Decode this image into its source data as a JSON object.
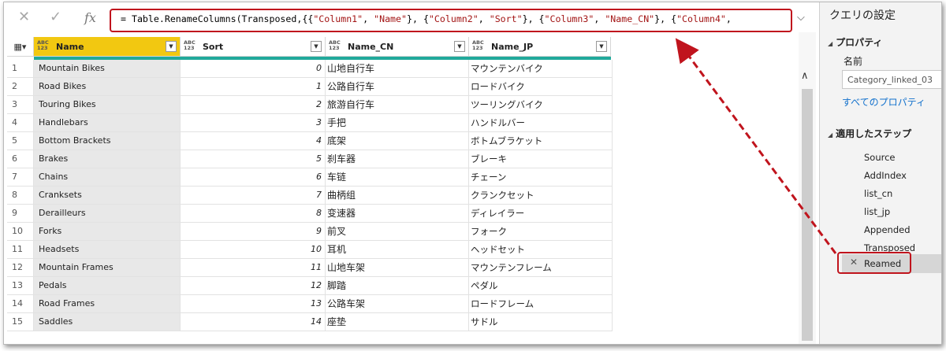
{
  "formula_bar": {
    "cancel_icon": "✕",
    "check_icon": "✓",
    "fx_label": "fx",
    "formula_parts": [
      {
        "t": "= Table.RenameColumns(Transposed,{{",
        "s": false
      },
      {
        "t": "\"Column1\"",
        "s": true
      },
      {
        "t": ", ",
        "s": false
      },
      {
        "t": "\"Name\"",
        "s": true
      },
      {
        "t": "}, {",
        "s": false
      },
      {
        "t": "\"Column2\"",
        "s": true
      },
      {
        "t": ", ",
        "s": false
      },
      {
        "t": "\"Sort\"",
        "s": true
      },
      {
        "t": "}, {",
        "s": false
      },
      {
        "t": "\"Column3\"",
        "s": true
      },
      {
        "t": ", ",
        "s": false
      },
      {
        "t": "\"Name_CN\"",
        "s": true
      },
      {
        "t": "}, {",
        "s": false
      },
      {
        "t": "\"Column4\"",
        "s": true
      },
      {
        "t": ",",
        "s": false
      }
    ],
    "expand_icon": "chevron-down-icon"
  },
  "table": {
    "type_badge": "ABC\n123",
    "columns": [
      {
        "label": "Name",
        "selected": true
      },
      {
        "label": "Sort",
        "selected": false
      },
      {
        "label": "Name_CN",
        "selected": false
      },
      {
        "label": "Name_JP",
        "selected": false
      }
    ],
    "rows": [
      {
        "idx": "1",
        "name": "Mountain Bikes",
        "sort": "0",
        "cn": "山地自行车",
        "jp": "マウンテンバイク"
      },
      {
        "idx": "2",
        "name": "Road Bikes",
        "sort": "1",
        "cn": "公路自行车",
        "jp": "ロードバイク"
      },
      {
        "idx": "3",
        "name": "Touring Bikes",
        "sort": "2",
        "cn": "旅游自行车",
        "jp": "ツーリングバイク"
      },
      {
        "idx": "4",
        "name": "Handlebars",
        "sort": "3",
        "cn": "手把",
        "jp": "ハンドルバー"
      },
      {
        "idx": "5",
        "name": "Bottom Brackets",
        "sort": "4",
        "cn": "底架",
        "jp": "ボトムブラケット"
      },
      {
        "idx": "6",
        "name": "Brakes",
        "sort": "5",
        "cn": "刹车器",
        "jp": "ブレーキ"
      },
      {
        "idx": "7",
        "name": "Chains",
        "sort": "6",
        "cn": "车链",
        "jp": "チェーン"
      },
      {
        "idx": "8",
        "name": "Cranksets",
        "sort": "7",
        "cn": "曲柄组",
        "jp": "クランクセット"
      },
      {
        "idx": "9",
        "name": "Derailleurs",
        "sort": "8",
        "cn": "变速器",
        "jp": "ディレイラー"
      },
      {
        "idx": "10",
        "name": "Forks",
        "sort": "9",
        "cn": "前叉",
        "jp": "フォーク"
      },
      {
        "idx": "11",
        "name": "Headsets",
        "sort": "10",
        "cn": "耳机",
        "jp": "ヘッドセット"
      },
      {
        "idx": "12",
        "name": "Mountain Frames",
        "sort": "11",
        "cn": "山地车架",
        "jp": "マウンテンフレーム"
      },
      {
        "idx": "13",
        "name": "Pedals",
        "sort": "12",
        "cn": "脚踏",
        "jp": "ペダル"
      },
      {
        "idx": "14",
        "name": "Road Frames",
        "sort": "13",
        "cn": "公路车架",
        "jp": "ロードフレーム"
      },
      {
        "idx": "15",
        "name": "Saddles",
        "sort": "14",
        "cn": "座垫",
        "jp": "サドル"
      }
    ]
  },
  "query_settings": {
    "title": "クエリの設定",
    "properties_heading": "プロパティ",
    "name_label": "名前",
    "name_value": "Category_linked_03",
    "all_properties_link": "すべてのプロパティ",
    "applied_steps_heading": "適用したステップ",
    "steps": [
      "Source",
      "AddIndex",
      "list_cn",
      "list_jp",
      "Appended",
      "Transposed"
    ],
    "active_step": "Reamed",
    "active_step_icon": "✕"
  },
  "colors": {
    "highlight_red": "#c0141d",
    "selected_header": "#f2c811",
    "quality_bar": "#21a99b",
    "link_blue": "#1170cc"
  }
}
